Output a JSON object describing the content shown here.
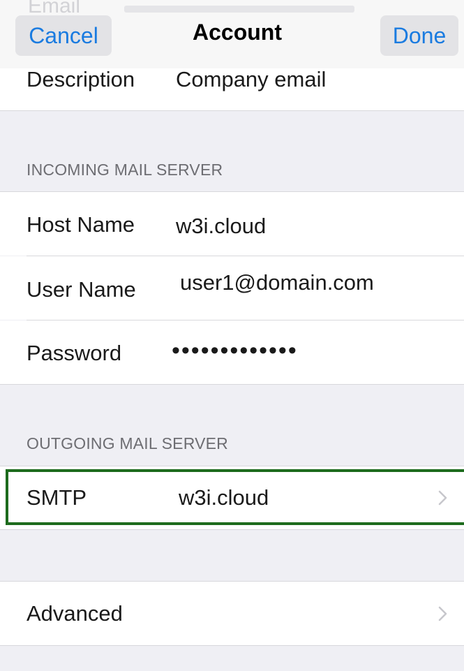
{
  "nav": {
    "cancel_label": "Cancel",
    "title": "Account",
    "done_label": "Done",
    "ghost_text": "Email"
  },
  "account": {
    "description_label": "Description",
    "description_value": "Company email"
  },
  "incoming": {
    "header": "INCOMING MAIL SERVER",
    "host_label": "Host Name",
    "host_value": "w3i.cloud",
    "user_label": "User Name",
    "user_value": "user1@domain.com",
    "password_label": "Password",
    "password_value": "•••••••••••••"
  },
  "outgoing": {
    "header": "OUTGOING MAIL SERVER",
    "smtp_label": "SMTP",
    "smtp_value": "w3i.cloud"
  },
  "advanced": {
    "label": "Advanced"
  },
  "colors": {
    "accent": "#1a7be0",
    "highlight": "#1d6b1d",
    "group_bg": "#efeff4"
  },
  "icons": {
    "disclosure": "chevron-right-icon"
  }
}
